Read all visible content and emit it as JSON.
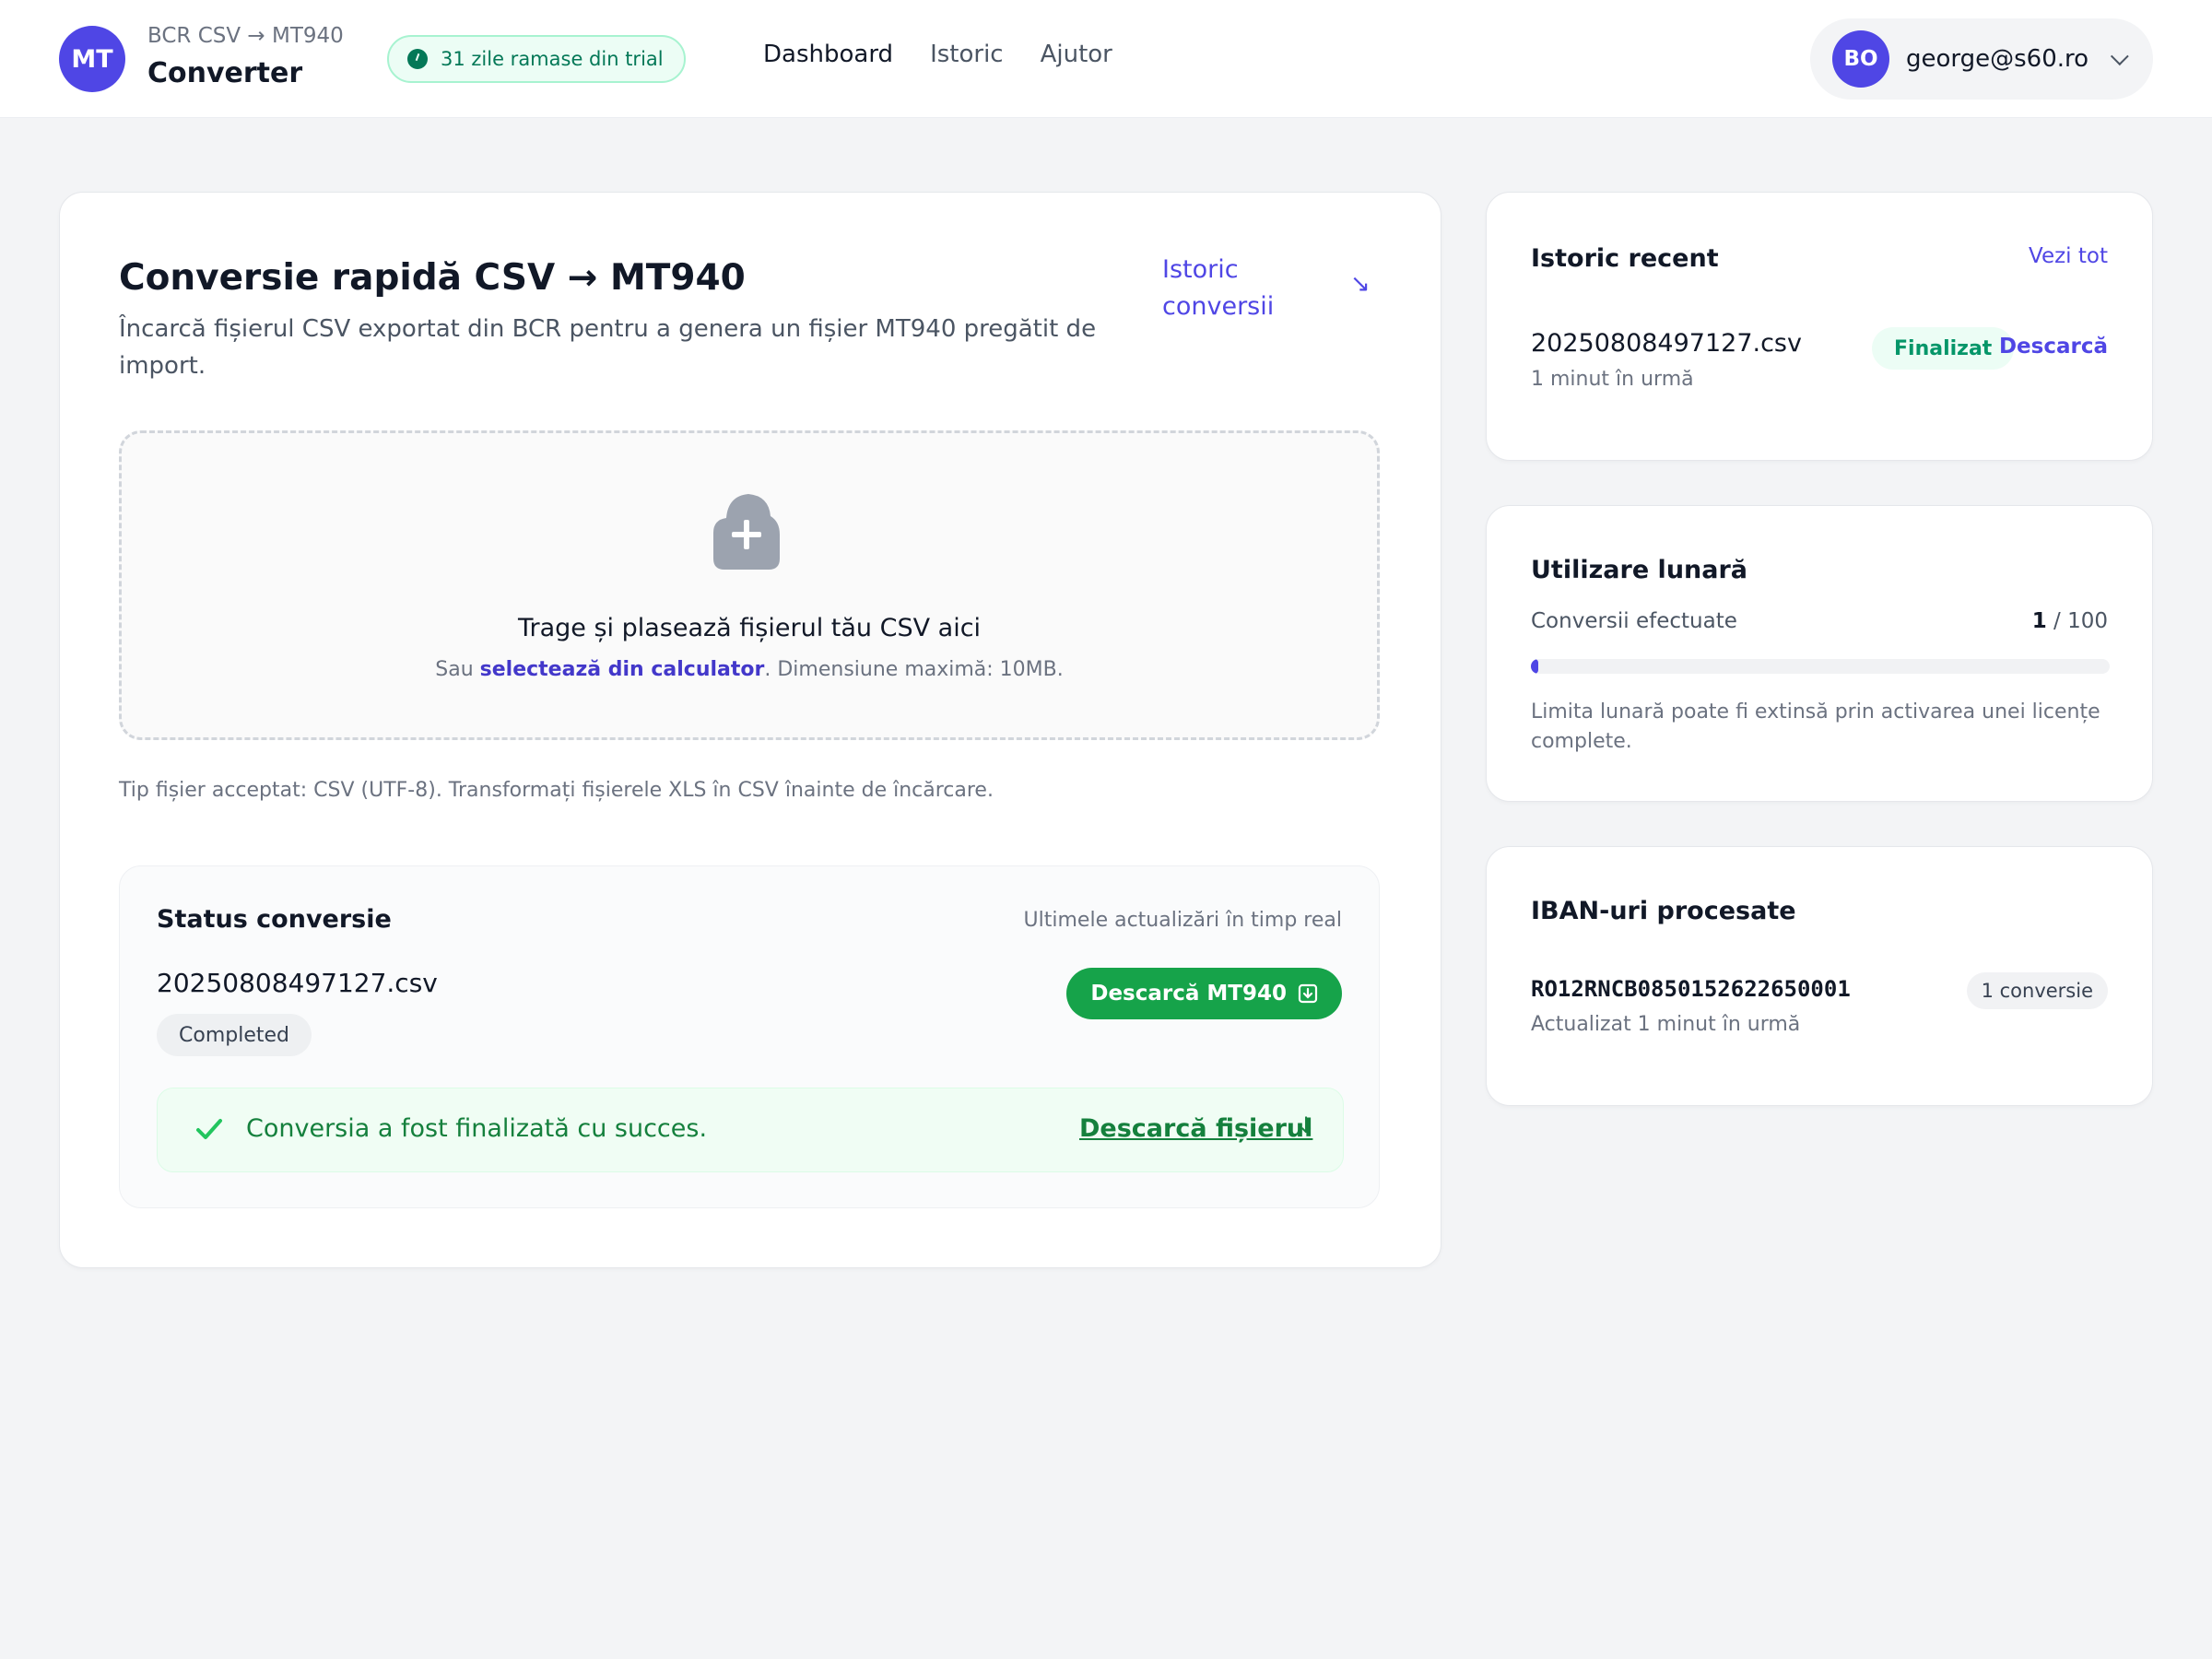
{
  "header": {
    "logo_initials": "MT",
    "brand_sub": "BCR CSV → MT940",
    "brand_title": "Converter",
    "trial_text": "31 zile ramase din trial",
    "nav": [
      "Dashboard",
      "Istoric",
      "Ajutor"
    ],
    "user_initials": "BO",
    "user_email": "george@s60.ro"
  },
  "main": {
    "title": "Conversie rapidă CSV → MT940",
    "description": "Încarcă fișierul CSV exportat din BCR pentru a genera un fișier MT940 pregătit de import.",
    "history_link": "Istoric conversii",
    "history_arrow": "↘",
    "drop_title": "Trage și plasează fișierul tău CSV aici",
    "drop_sub_prefix": "Sau ",
    "drop_sub_link": "selectează din calculator",
    "drop_sub_suffix": ". Dimensiune maximă: 10MB.",
    "file_hint": "Tip fișier acceptat: CSV (UTF-8). Transformați fișierele XLS în CSV înainte de încărcare."
  },
  "status": {
    "title": "Status conversie",
    "live_note": "Ultimele actualizări în timp real",
    "file_name": "20250808497127.csv",
    "badge": "Completed",
    "download_button": "Descarcă MT940",
    "success_text": "Conversia a fost finalizată cu succes.",
    "success_link": "Descarcă fișierul",
    "success_arrow": "↓"
  },
  "recent": {
    "title": "Istoric recent",
    "see_all": "Vezi tot",
    "file_name": "20250808497127.csv",
    "time": "1 minut în urmă",
    "badge": "Finalizat",
    "download": "Descarcă"
  },
  "usage": {
    "title": "Utilizare lunară",
    "label": "Conversii efectuate",
    "used": "1",
    "limit_text": " / 100",
    "progress_fraction": 0.01,
    "note": "Limita lunară poate fi extinsă prin activarea unei licențe complete."
  },
  "iban": {
    "title": "IBAN-uri procesate",
    "code": "RO12RNCB0850152622650001",
    "badge": "1 conversie",
    "updated": "Actualizat 1 minut în urmă"
  },
  "colors": {
    "accent": "#4f46e5",
    "success": "#16a34a",
    "background": "#f3f4f6"
  },
  "icons": [
    "clock-icon",
    "chevron-down-icon",
    "arrow-down-right-icon",
    "upload-cloud-icon",
    "download-icon",
    "check-icon",
    "arrow-down-icon"
  ]
}
